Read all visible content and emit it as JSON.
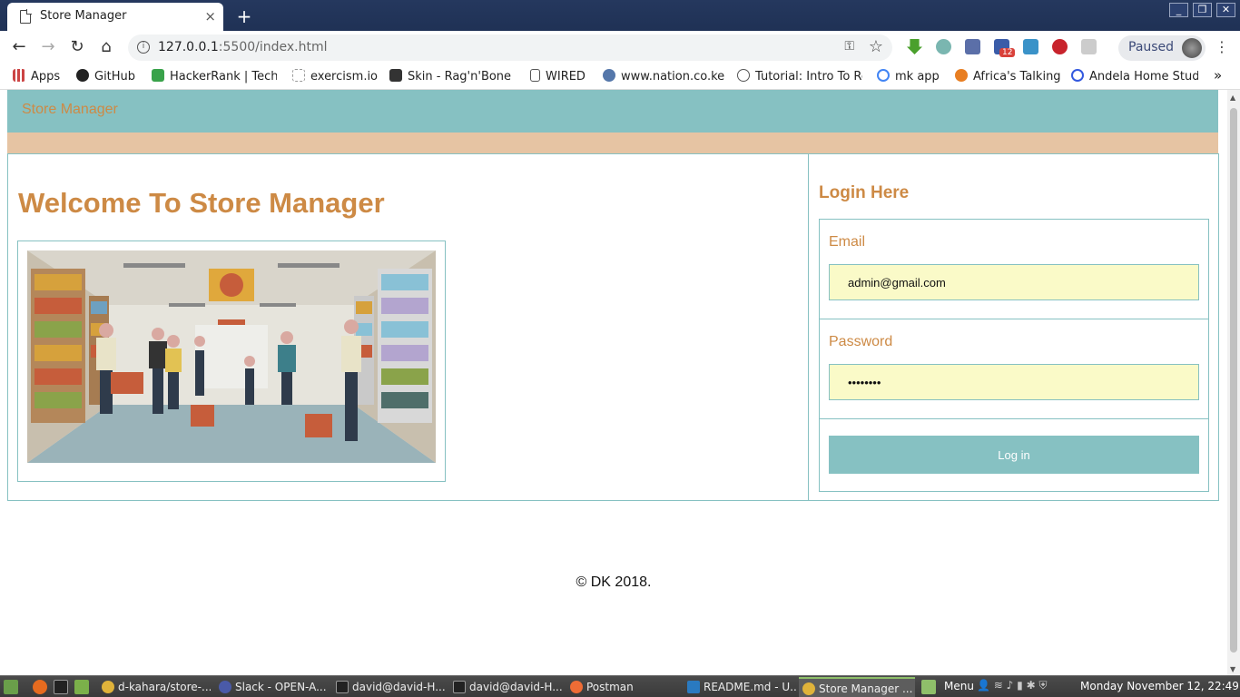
{
  "browser": {
    "tab_title": "Store Manager",
    "tab_close": "×",
    "new_tab": "+",
    "url_host": "127.0.0.1",
    "url_rest": ":5500/index.html",
    "profile_status": "Paused",
    "extension_badge": "12",
    "window_controls": [
      "_",
      "❐",
      "✕"
    ]
  },
  "bookmarks": [
    {
      "label": "Apps",
      "icon": "apps-grid-icon"
    },
    {
      "label": "GitHub",
      "icon": "github-icon"
    },
    {
      "label": "HackerRank | Techn",
      "icon": "hackerrank-icon"
    },
    {
      "label": "exercism.io",
      "icon": "exercism-icon"
    },
    {
      "label": "Skin - Rag'n'Bone M",
      "icon": "skin-icon"
    },
    {
      "label": "WIRED",
      "icon": "document-icon"
    },
    {
      "label": "www.nation.co.ke",
      "icon": "globe-icon"
    },
    {
      "label": "Tutorial: Intro To Re",
      "icon": "react-icon"
    },
    {
      "label": "mk app",
      "icon": "google-icon"
    },
    {
      "label": "Africa's Talking",
      "icon": "africastalking-icon"
    },
    {
      "label": "Andela Home Stud",
      "icon": "andela-icon"
    }
  ],
  "bookmarks_overflow": "»",
  "page": {
    "brand": "Store Manager",
    "welcome_heading": "Welcome To Store Manager",
    "login_heading": "Login Here",
    "email_label": "Email",
    "email_value": "admin@gmail.com",
    "password_label": "Password",
    "password_value": "password",
    "login_button": "Log in",
    "footer": "©  DK  2018."
  },
  "taskbar": {
    "items": [
      {
        "label": "d-kahara/store-..."
      },
      {
        "label": "Slack - OPEN-A..."
      },
      {
        "label": "david@david-H..."
      },
      {
        "label": "david@david-H..."
      },
      {
        "label": "Postman"
      },
      {
        "label": "README.md - U..."
      },
      {
        "label": "Store Manager ..."
      }
    ],
    "menu_label": "Menu",
    "clock": "Monday November 12, 22:49"
  },
  "colors": {
    "teal": "#86c1c2",
    "tan": "#e6c4a3",
    "orange": "#cd8a45",
    "input_bg": "#fafac8"
  }
}
